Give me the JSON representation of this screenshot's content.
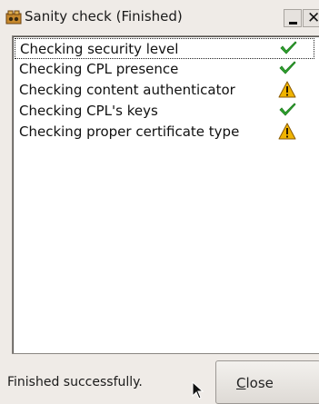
{
  "window": {
    "title": "Sanity check (Finished)",
    "icon": "app-icon",
    "buttons": [
      "minimize-icon",
      "close-icon"
    ]
  },
  "checks": [
    {
      "label": "Checking security level",
      "status": "ok",
      "icon": "checkmark-icon",
      "color": "#2fa52f"
    },
    {
      "label": "Checking CPL presence",
      "status": "ok",
      "icon": "checkmark-icon",
      "color": "#2fa52f"
    },
    {
      "label": "Checking content authenticator",
      "status": "warning",
      "icon": "warning-icon",
      "color": "#f0b400"
    },
    {
      "label": "Checking CPL's keys",
      "status": "ok",
      "icon": "checkmark-icon",
      "color": "#2fa52f"
    },
    {
      "label": "Checking proper certificate type",
      "status": "warning",
      "icon": "warning-icon",
      "color": "#f0b400"
    }
  ],
  "footer": {
    "status_text": "Finished successfully.",
    "close_label_mnemonic": "C",
    "close_label_rest": "lose"
  }
}
